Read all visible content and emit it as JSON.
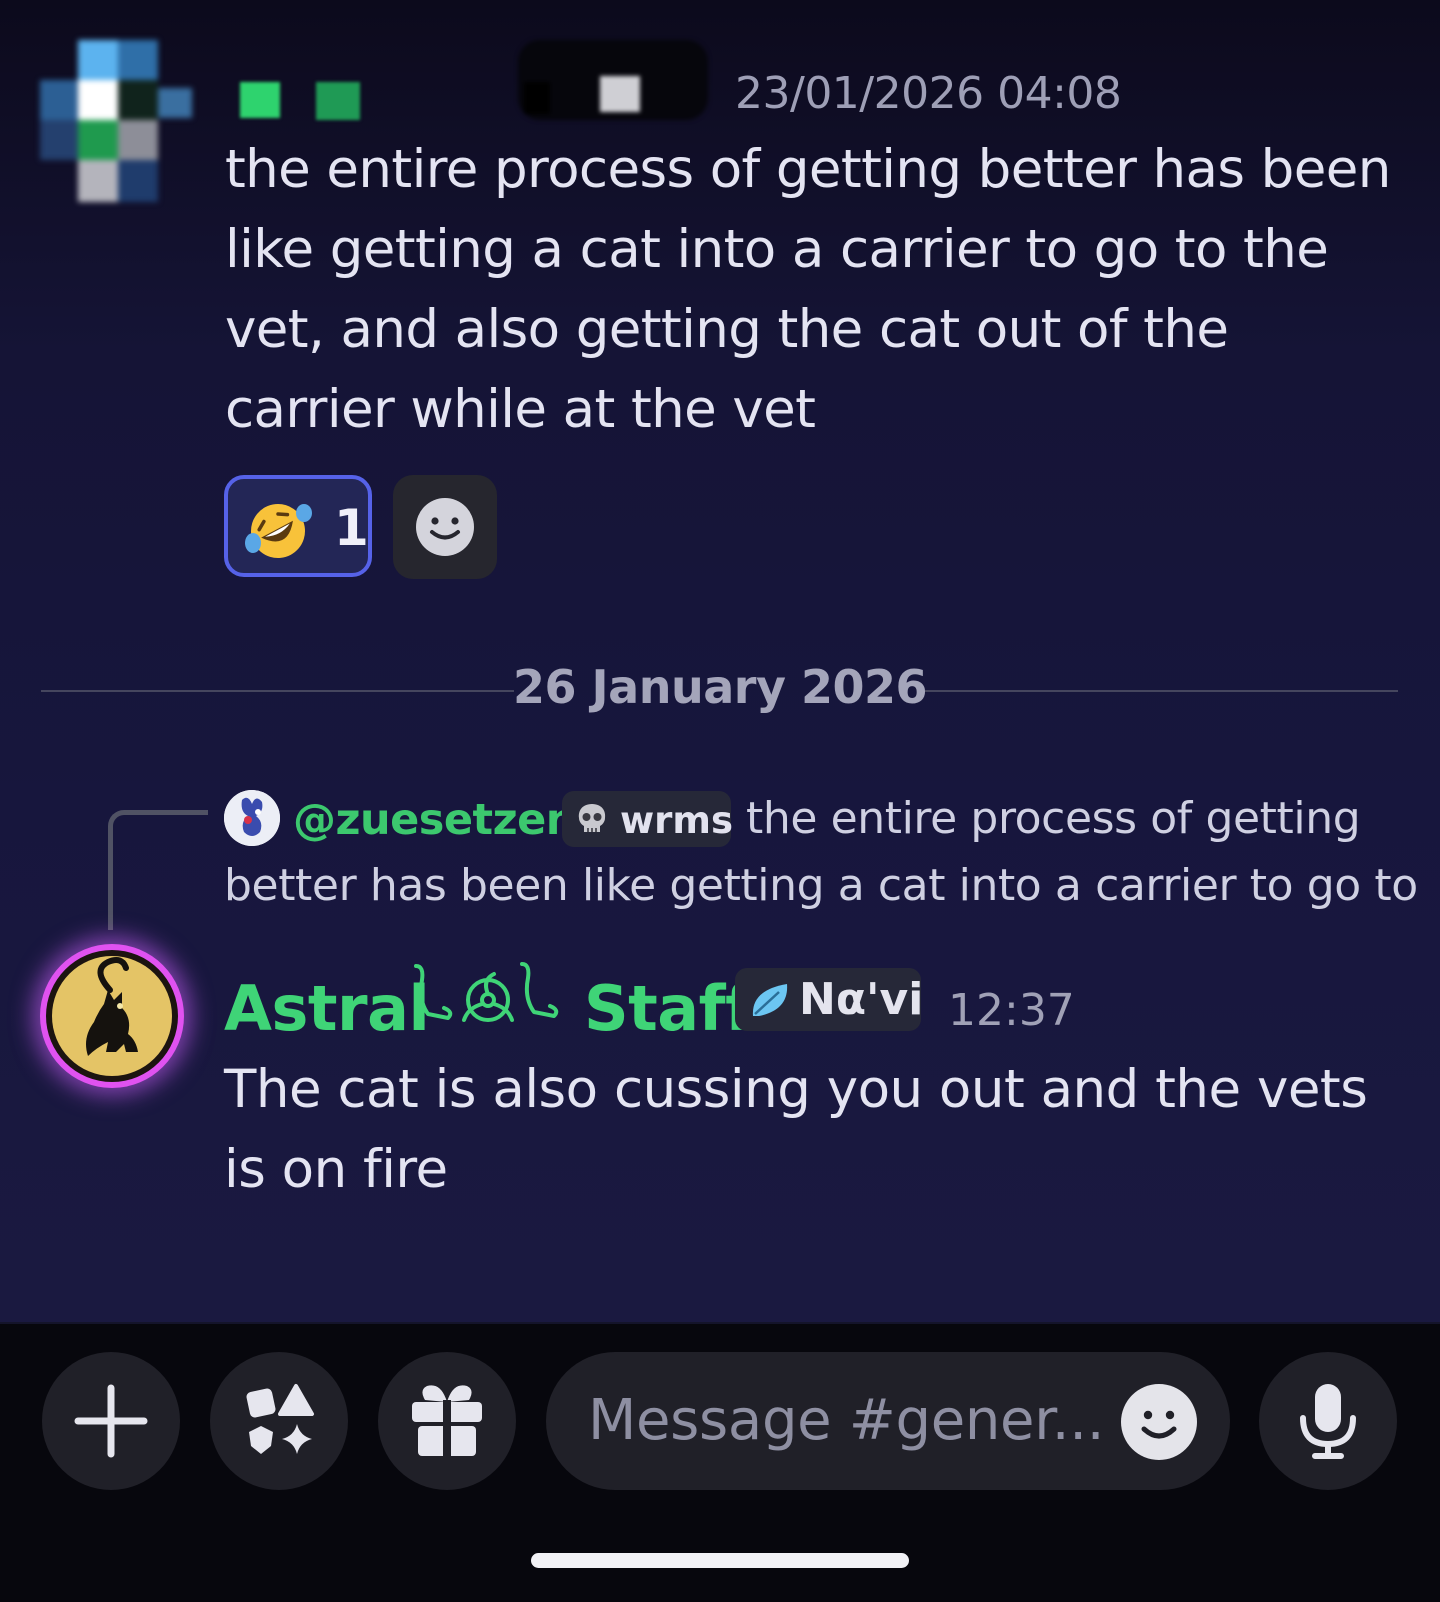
{
  "messages": [
    {
      "timestamp": "23/01/2026 04:08",
      "text": "the entire process of getting better has been like getting a cat into a carrier to go to the vet, and also getting the cat out of the carrier while at the vet",
      "reactions": [
        {
          "emoji": "rolling-on-floor-laughing",
          "count": "1"
        }
      ]
    }
  ],
  "date_divider": "26 January 2026",
  "reply": {
    "handle": "@zuesetzen",
    "tag": "wrms",
    "preview_line1": "the entire process of getting",
    "preview_line2": "better has been like getting a cat into a carrier to go to"
  },
  "message2": {
    "author_part1": "Astral",
    "author_part2": "Staff",
    "role_tag": "Nα'vi",
    "timestamp": "12:37",
    "text": "The cat is also cussing you out and the vets is on fire"
  },
  "composer": {
    "placeholder": "Message #gener..."
  },
  "icons": [
    "plus-icon",
    "apps-icon",
    "gift-icon",
    "emoji-icon",
    "microphone-icon"
  ],
  "colors": {
    "accent_green": "#3fd477",
    "reaction_border": "#5662e8",
    "avatar_glow": "#ce60ff"
  }
}
